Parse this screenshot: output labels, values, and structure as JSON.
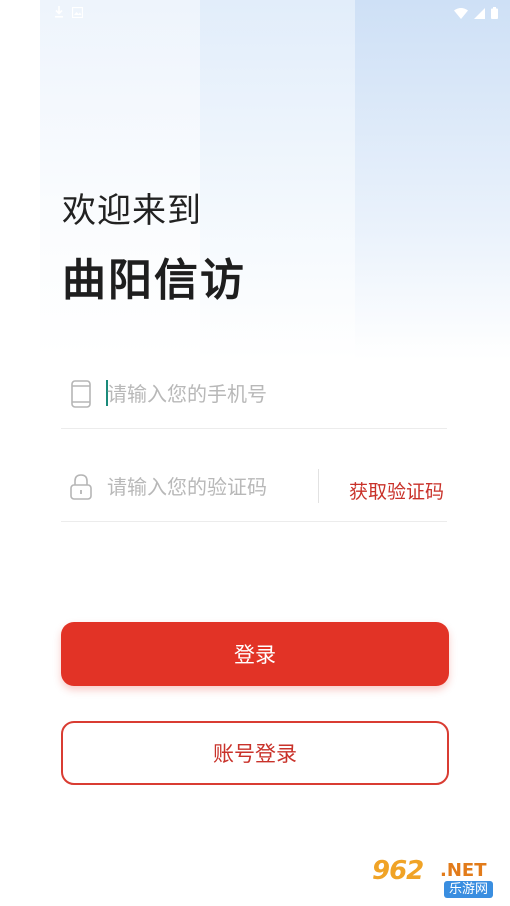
{
  "status_bar": {
    "left_icons": [
      "download-icon",
      "image-icon"
    ],
    "right_icons": [
      "wifi-icon",
      "signal-icon",
      "battery-icon"
    ]
  },
  "header": {
    "greeting": "欢迎来到",
    "app_name": "曲阳信访"
  },
  "form": {
    "phone": {
      "placeholder": "请输入您的手机号",
      "value": "",
      "icon": "phone-icon"
    },
    "code": {
      "placeholder": "请输入您的验证码",
      "value": "",
      "icon": "lock-icon",
      "get_code_label": "获取验证码"
    }
  },
  "buttons": {
    "login_label": "登录",
    "account_login_label": "账号登录"
  },
  "watermark": {
    "main": "962",
    "suffix": ".NET",
    "sub": "乐游网"
  },
  "colors": {
    "primary": "#e23326",
    "primary_text": "#c9322a",
    "placeholder": "#b8b8b8",
    "caret": "#1a8a7a"
  }
}
